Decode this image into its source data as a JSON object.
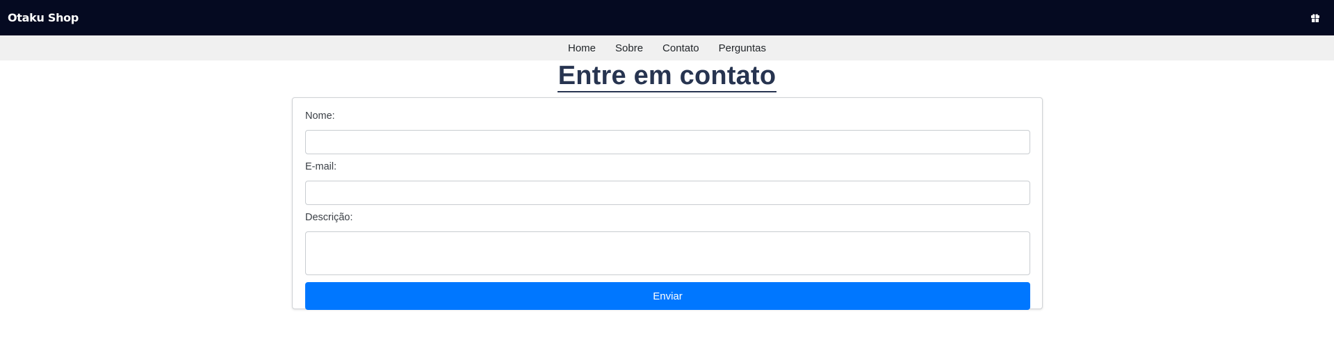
{
  "header": {
    "brand": "Otaku Shop",
    "cart_icon": "gift-box-icon",
    "background": "#050a21"
  },
  "nav": {
    "items": [
      {
        "label": "Home"
      },
      {
        "label": "Sobre"
      },
      {
        "label": "Contato"
      },
      {
        "label": "Perguntas"
      }
    ]
  },
  "page": {
    "title": "Entre em contato"
  },
  "form": {
    "name_label": "Nome:",
    "name_value": "",
    "email_label": "E-mail:",
    "email_value": "",
    "description_label": "Descrição:",
    "description_value": "",
    "submit_label": "Enviar",
    "accent": "#0077ff"
  }
}
